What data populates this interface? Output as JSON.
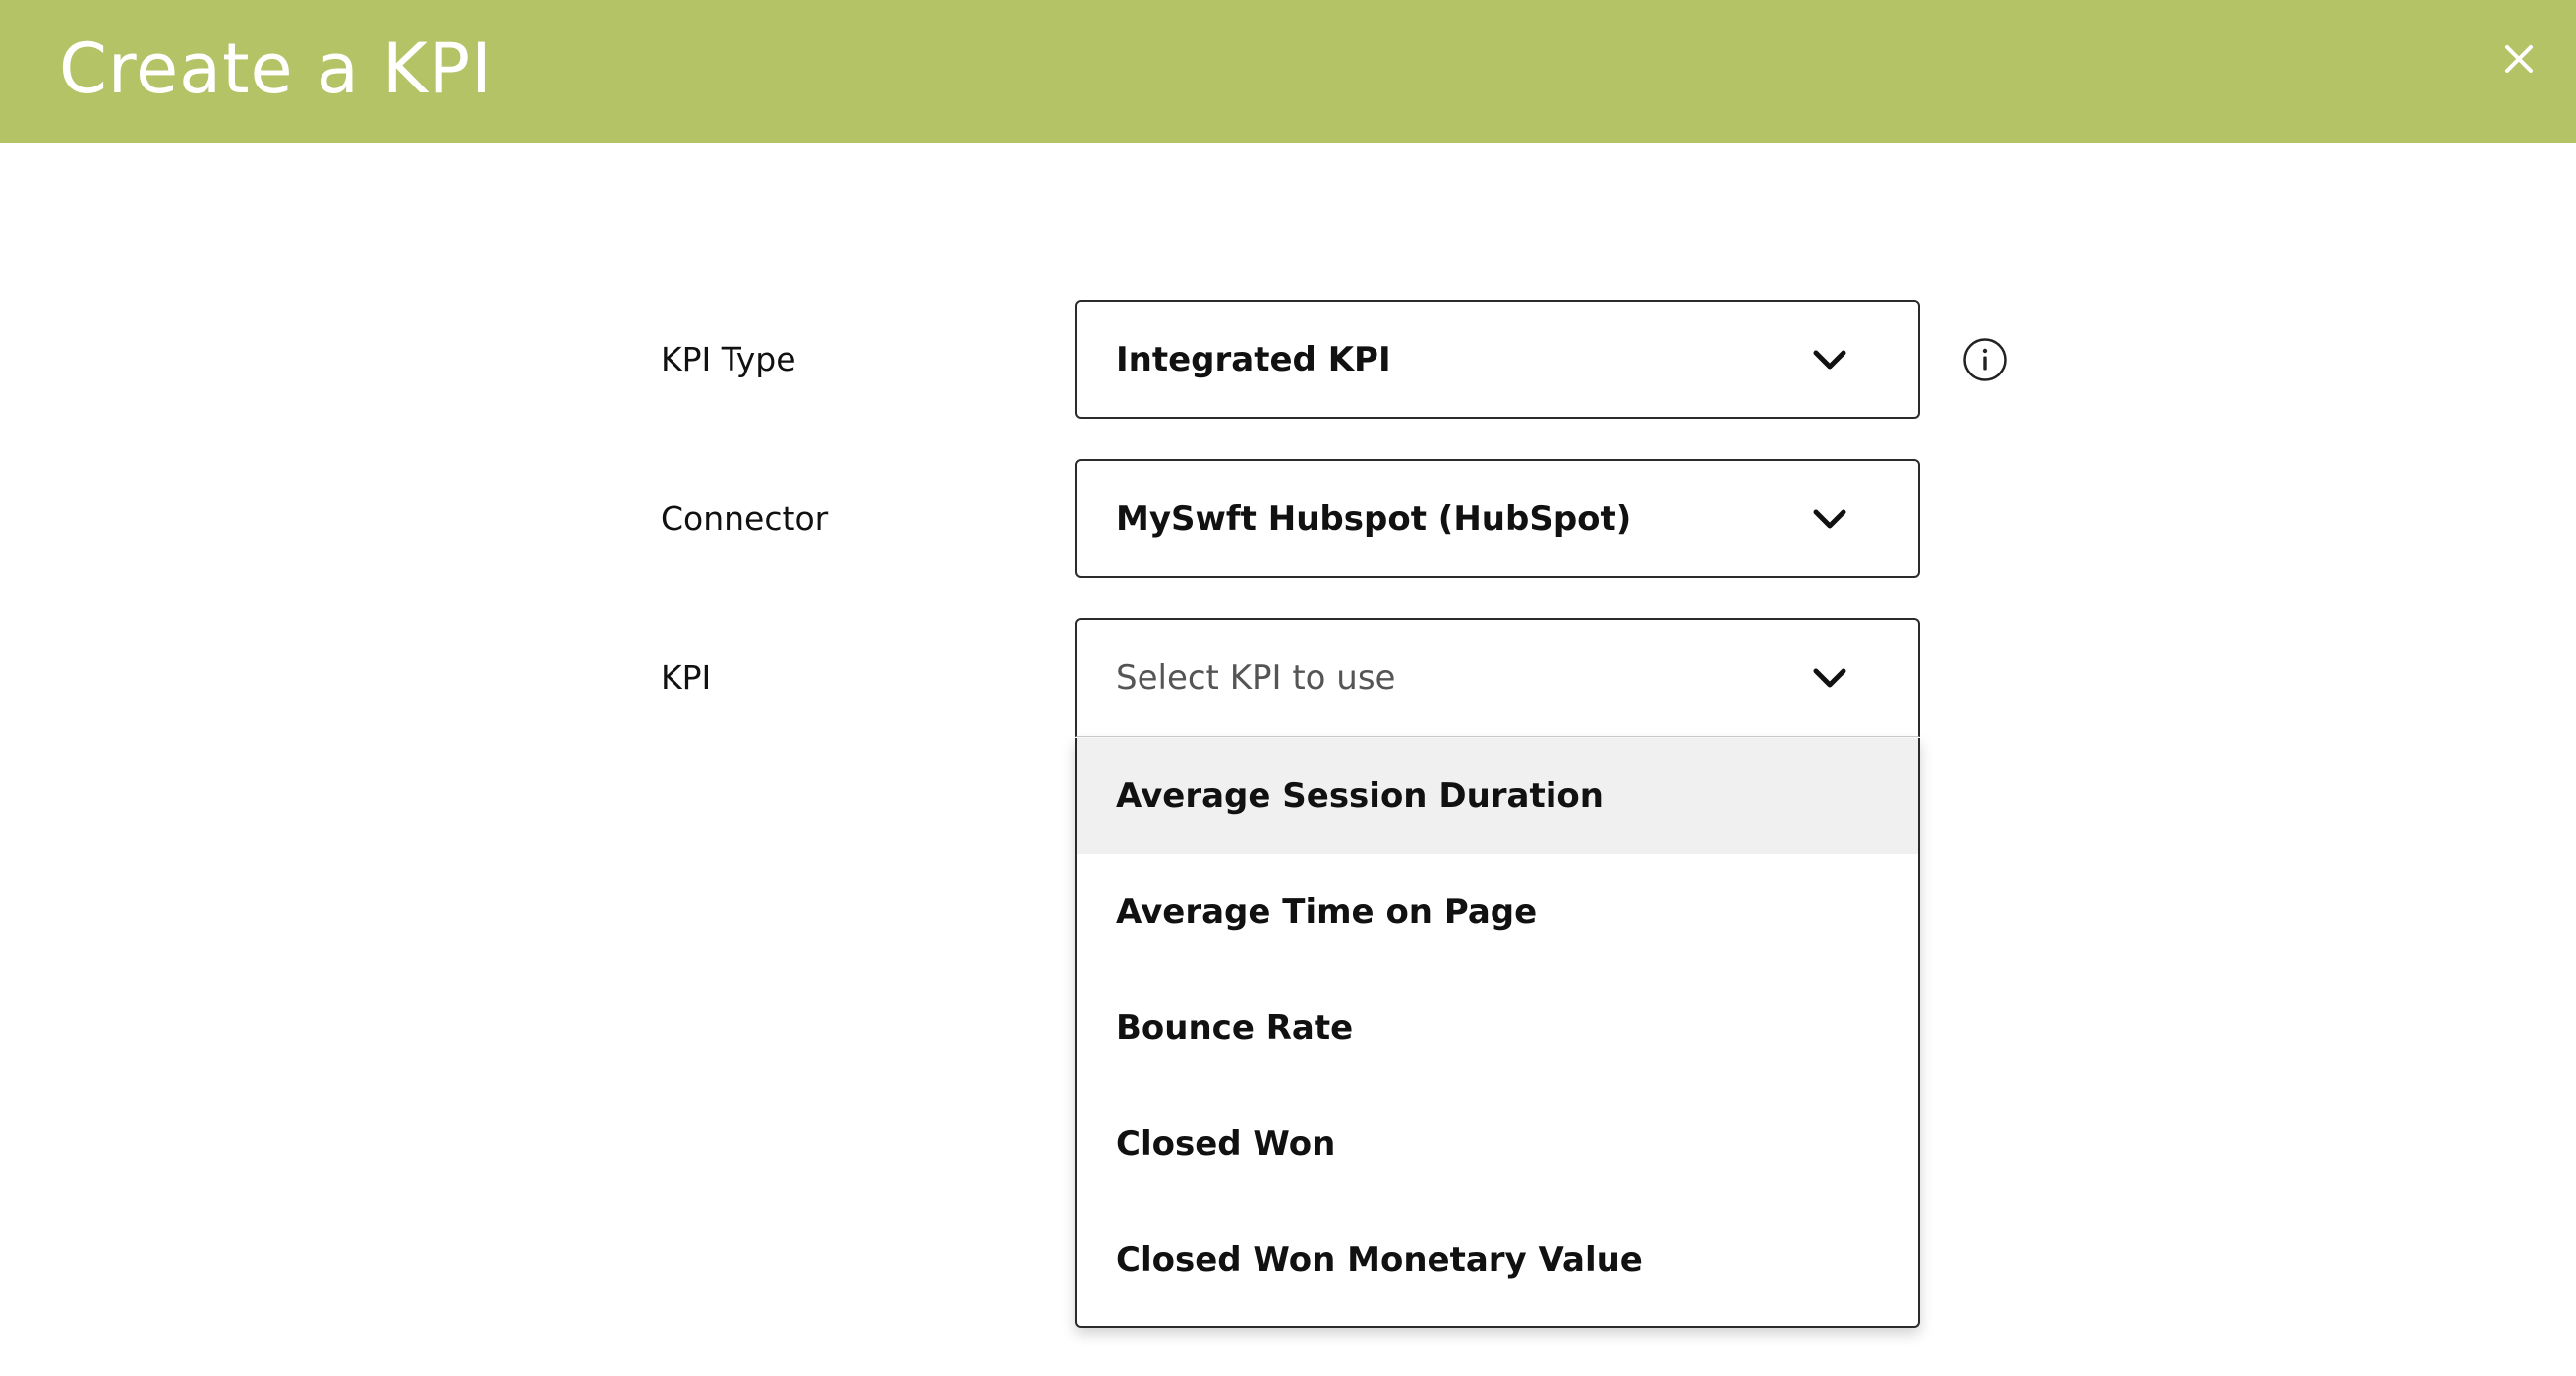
{
  "header": {
    "title": "Create a KPI",
    "background_color": "#b5c367"
  },
  "form": {
    "kpi_type": {
      "label": "KPI Type",
      "value": "Integrated KPI"
    },
    "connector": {
      "label": "Connector",
      "value": "MySwft Hubspot (HubSpot)"
    },
    "kpi": {
      "label": "KPI",
      "placeholder": "Select KPI to use",
      "options": [
        "Average Session Duration",
        "Average Time on Page",
        "Bounce Rate",
        "Closed Won",
        "Closed Won Monetary Value"
      ],
      "highlighted_option": "Average Session Duration"
    }
  },
  "icons": {
    "close": "close-icon",
    "info": "info-icon",
    "chevron": "chevron-down-icon"
  }
}
